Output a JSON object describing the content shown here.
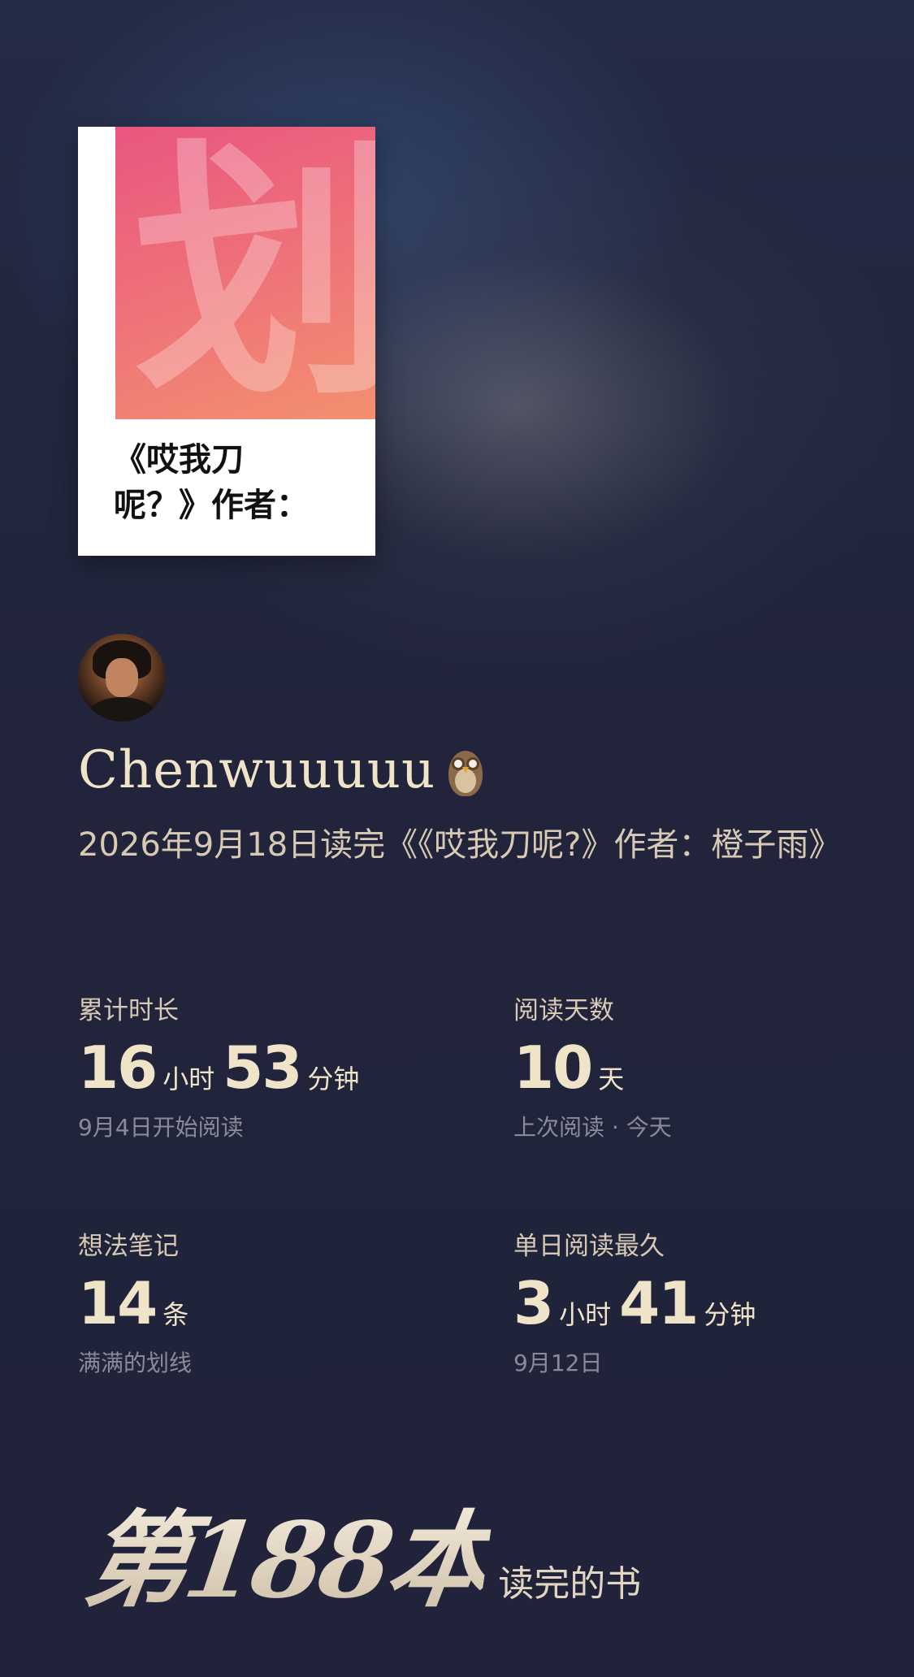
{
  "book": {
    "cover_glyph": "划",
    "cover_title_line1": "《哎我刀",
    "cover_title_line2": "呢？》作者："
  },
  "user": {
    "name": "Chenwuuuuu"
  },
  "finish_text": "2026年9月18日读完《《哎我刀呢?》作者：橙子雨》",
  "stats": {
    "total_time": {
      "label": "累计时长",
      "hours": "16",
      "hours_unit": "小时",
      "minutes": "53",
      "minutes_unit": "分钟",
      "sub": "9月4日开始阅读"
    },
    "reading_days": {
      "label": "阅读天数",
      "value": "10",
      "unit": "天",
      "sub": "上次阅读 · 今天"
    },
    "notes": {
      "label": "想法笔记",
      "value": "14",
      "unit": "条",
      "sub": "满满的划线"
    },
    "longest_day": {
      "label": "单日阅读最久",
      "hours": "3",
      "hours_unit": "小时",
      "minutes": "41",
      "minutes_unit": "分钟",
      "sub": "9月12日"
    }
  },
  "ordinal": {
    "big": "第188本",
    "suffix": "读完的书"
  },
  "colors": {
    "background": "#21243a",
    "accent_text": "#efe3c8",
    "cover_gradient_start": "#e9567f",
    "cover_gradient_end": "#f3906f"
  },
  "icons": {
    "name_badge": "owl-icon"
  }
}
